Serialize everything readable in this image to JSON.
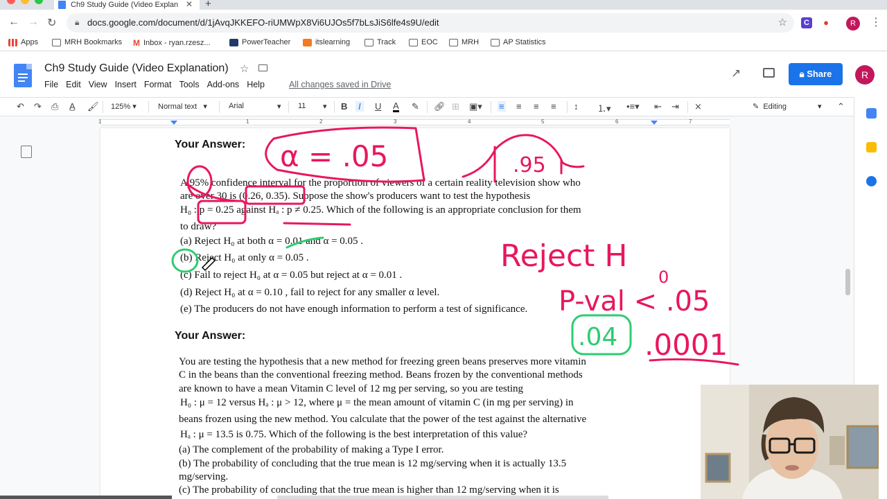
{
  "browser": {
    "tab_title": "Ch9 Study Guide (Video Explan",
    "url": "docs.google.com/document/d/1jAvqJKKEFO-riUMWpX8Vi6UJOs5f7bLsJiS6lfe4s9U/edit",
    "profile_initial": "R"
  },
  "bookmarks": [
    {
      "label": "Apps",
      "icon": "apps-grid-icon"
    },
    {
      "label": "MRH Bookmarks",
      "icon": "folder-icon"
    },
    {
      "label": "Inbox - ryan.rzesz...",
      "icon": "gmail-icon"
    },
    {
      "label": "PowerTeacher",
      "icon": "powerteacher-icon"
    },
    {
      "label": "itslearning",
      "icon": "itslearning-icon"
    },
    {
      "label": "Track",
      "icon": "folder-icon"
    },
    {
      "label": "EOC",
      "icon": "folder-icon"
    },
    {
      "label": "MRH",
      "icon": "folder-icon"
    },
    {
      "label": "AP Statistics",
      "icon": "folder-icon"
    }
  ],
  "docs": {
    "title": "Ch9 Study Guide (Video Explanation)",
    "menu": [
      "File",
      "Edit",
      "View",
      "Insert",
      "Format",
      "Tools",
      "Add-ons",
      "Help"
    ],
    "saved_status": "All changes saved in Drive",
    "share_label": "Share",
    "avatar_initial": "R"
  },
  "toolbar": {
    "zoom": "125%",
    "style": "Normal text",
    "font": "Arial",
    "size": "11",
    "mode": "Editing"
  },
  "ruler": [
    "1",
    "1",
    "2",
    "3",
    "4",
    "5",
    "6",
    "7"
  ],
  "document": {
    "answer_heading_1": "Your Answer:",
    "q1_lines": [
      "A 95% confidence interval for the proportion of viewers of a certain reality television show who",
      "are over 30  is (0.26, 0.35). Suppose the show's producers want to test the hypothesis",
      "H₀ : p = 0.25 against  Hₐ : p ≠ 0.25.  Which of the following is an appropriate conclusion for them",
      "to draw?"
    ],
    "q1_options": [
      "(a)  Reject  H₀  at both  α = 0.01 and  α = 0.05 .",
      "(b)  Reject  H₀  at only  α = 0.05 .",
      "(c)  Fail to reject  H₀  at  α = 0.05 but reject at  α = 0.01 .",
      "(d)  Reject  H₀  at  α = 0.10 , fail to reject for any smaller  α  level.",
      "(e)  The producers do not have enough information to perform a test of significance."
    ],
    "answer_heading_2": "Your Answer:",
    "q2_lines": [
      "You are testing the hypothesis that a new method for freezing green beans preserves more vitamin",
      "C in the beans than the conventional freezing method.  Beans frozen by the conventional methods",
      "are known to have a mean Vitamin C level of 12 mg per serving, so you are testing",
      "H₀ : μ = 12 versus   Hₐ : μ > 12, where μ = the mean amount of vitamin C (in mg per serving) in",
      "beans frozen using the new method.  You calculate that the power of the test against the alternative",
      "Hₐ : μ = 13.5  is 0.75.  Which of the following is the best interpretation of this value?",
      "(a)  The complement of the probability of making a Type I error.",
      "(b)  The probability of concluding that the true mean is 12 mg/serving when it is actually 13.5",
      "       mg/serving.",
      "(c)  The probability of concluding that the true mean is higher than 12 mg/serving when it is"
    ]
  },
  "ink": {
    "alpha": "α = .05",
    "curve_label": ".95",
    "reject": "Reject  H",
    "reject_sub": "0",
    "pval": "P-val < .05",
    "p1": ".04",
    "p2": ".0001",
    "colors": {
      "pink": "#e8175d",
      "green": "#2ecc71"
    }
  }
}
